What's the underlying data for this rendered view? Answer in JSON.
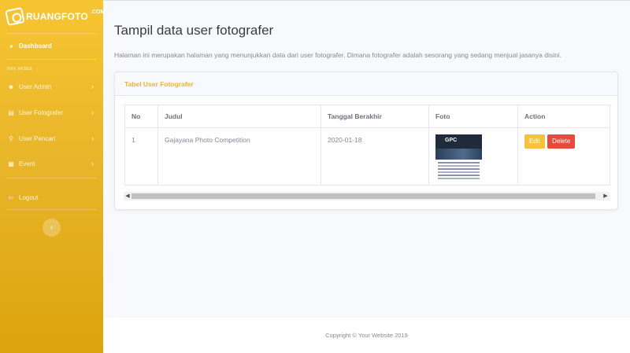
{
  "brand": {
    "name": "RUANGFOTO",
    "suffix": ".COM"
  },
  "sidebar": {
    "dashboard": "Dashboard",
    "heading": "HAK AKSES",
    "items": [
      {
        "label": "User Admin",
        "icon": "users-icon"
      },
      {
        "label": "User Fotografer",
        "icon": "id-card-icon"
      },
      {
        "label": "User Pencari",
        "icon": "search-icon"
      },
      {
        "label": "Event",
        "icon": "calendar-icon"
      }
    ],
    "logout": "Logout",
    "toggle": "‹"
  },
  "page": {
    "title": "Tampil data user fotografer",
    "description": "Halaman ini merupakan halaman yang menunjukkan data dari user fotografer. Dimana fotografer adalah sesorang yang sedang menjual jasanya disini."
  },
  "card": {
    "title": "Tabel User Fotografer"
  },
  "table": {
    "headers": [
      "No",
      "Judul",
      "Tanggal Berakhir",
      "Foto",
      "Action"
    ],
    "rows": [
      {
        "no": "1",
        "judul": "Gajayana Photo Competition",
        "tanggal": "2020-01-18",
        "edit": "Edit",
        "delete": "Delete"
      }
    ]
  },
  "thumb": {
    "text": "GPC"
  },
  "footer": {
    "text": "Copyright © Your Website 2019"
  },
  "colors": {
    "accent": "#f6c23e",
    "danger": "#e74a3b",
    "sidebar": "#f7c531"
  }
}
